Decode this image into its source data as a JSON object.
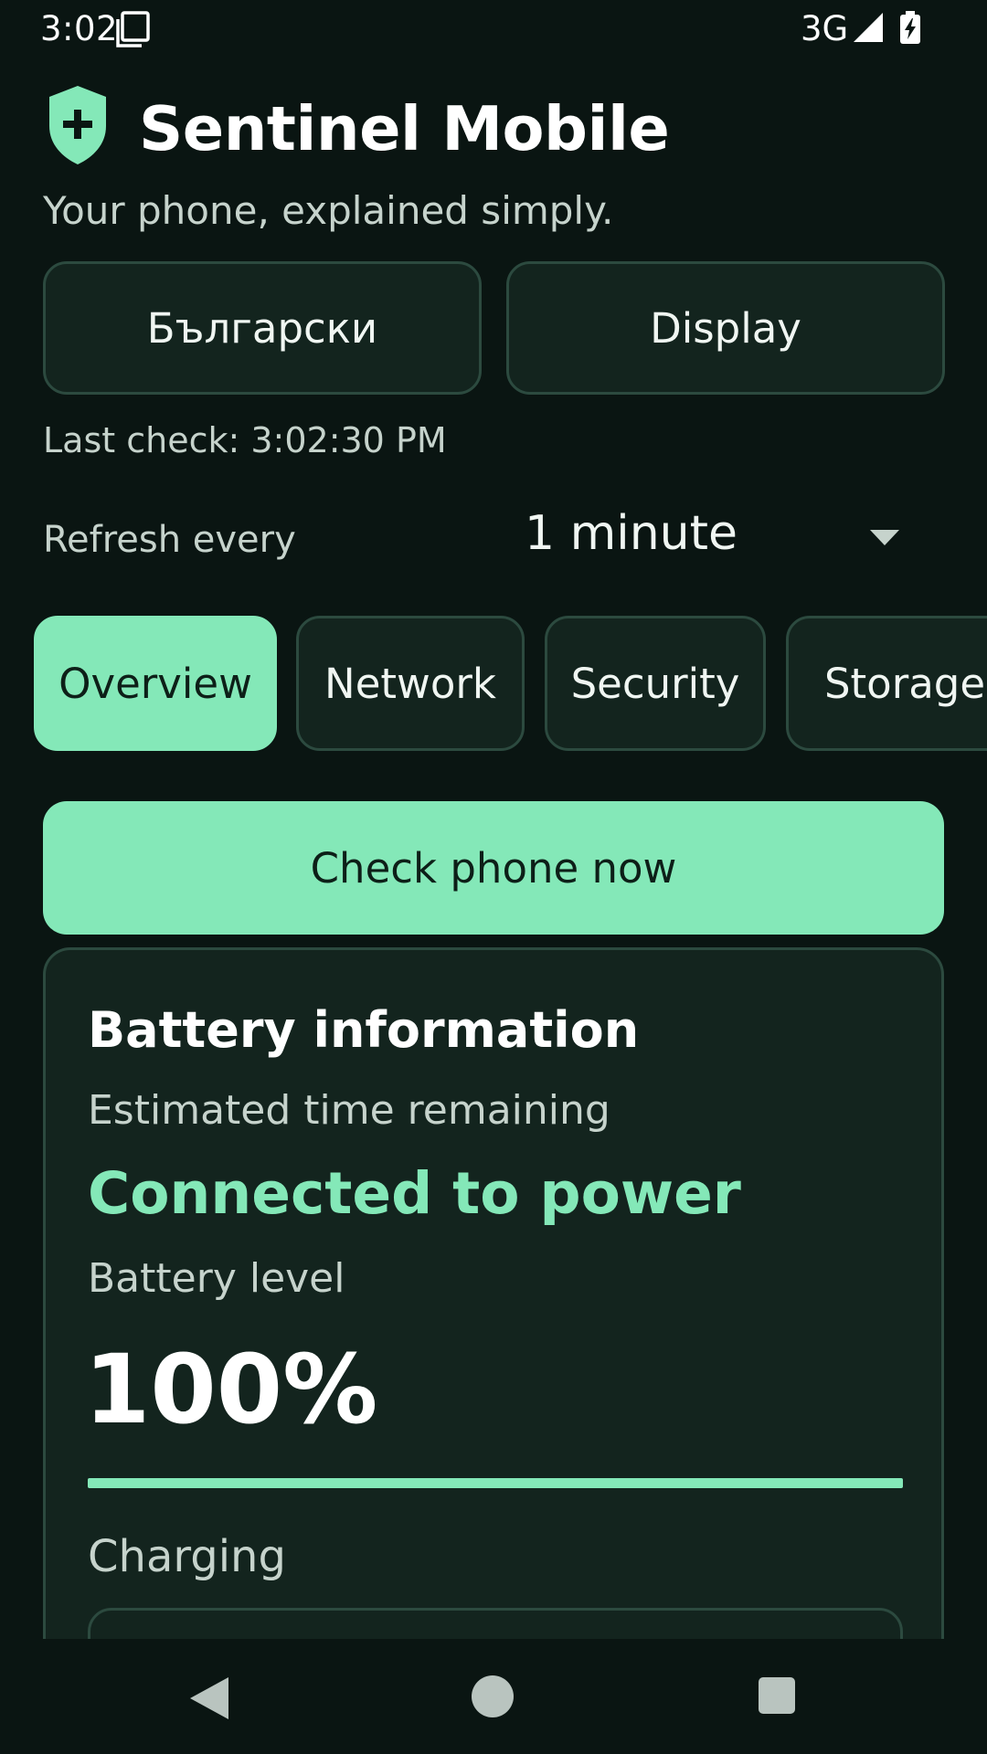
{
  "status_bar": {
    "time": "3:02",
    "network": "3G"
  },
  "header": {
    "title": "Sentinel Mobile",
    "tagline": "Your phone, explained simply."
  },
  "top_buttons": {
    "language": "Български",
    "display": "Display"
  },
  "last_check": "Last check: 3:02:30 PM",
  "refresh": {
    "label": "Refresh every",
    "value": "1 minute"
  },
  "tabs": [
    {
      "label": "Overview",
      "active": true
    },
    {
      "label": "Network",
      "active": false
    },
    {
      "label": "Security",
      "active": false
    },
    {
      "label": "Storage",
      "active": false
    }
  ],
  "check_button": "Check phone now",
  "battery_card": {
    "title": "Battery information",
    "estimated_label": "Estimated time remaining",
    "power_status": "Connected to power",
    "level_label": "Battery level",
    "level_value": "100%",
    "level_percent": 100,
    "charging_label": "Charging"
  },
  "colors": {
    "accent": "#84e8b8",
    "background": "#0a1512",
    "card": "#13241e",
    "border": "#2c4a3f"
  },
  "icons": {
    "logo": "shield-plus-icon",
    "sim": "sim-card-icon",
    "signal": "signal-icon",
    "battery": "battery-charging-icon",
    "dropdown": "chevron-down-icon",
    "nav_back": "back-triangle-icon",
    "nav_home": "home-circle-icon",
    "nav_recents": "recents-square-icon"
  }
}
